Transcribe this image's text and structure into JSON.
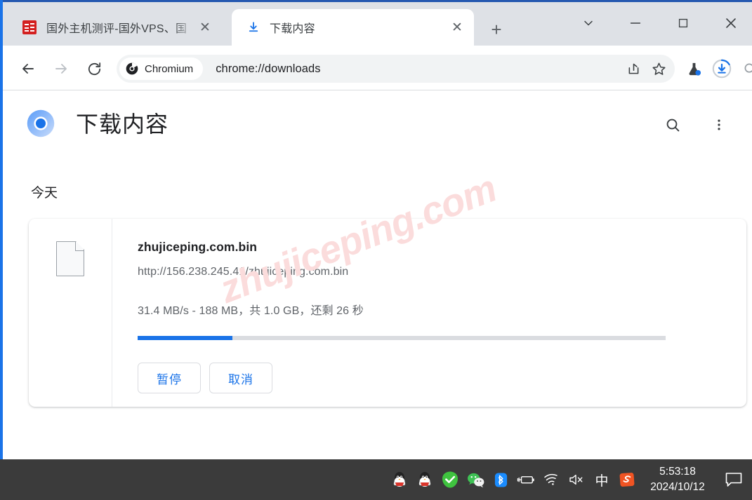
{
  "window": {
    "controls": [
      {
        "name": "tab-search",
        "icon": "chevron-down-icon",
        "label": "∨"
      },
      {
        "name": "minimize",
        "icon": "minimize-icon",
        "label": "—"
      },
      {
        "name": "maximize",
        "icon": "maximize-icon",
        "label": "□"
      },
      {
        "name": "close",
        "icon": "close-icon",
        "label": "✕"
      }
    ],
    "accent_color": "#1a73e8",
    "frame_color": "#dee1e6"
  },
  "tabs": [
    {
      "title": "国外主机测评-国外VPS、国",
      "favicon": "red-seal-favicon",
      "active": false,
      "close_label": "✕"
    },
    {
      "title": "下载内容",
      "favicon": "download-icon",
      "active": true,
      "close_label": "✕"
    }
  ],
  "newtab": {
    "label": "+",
    "name": "new-tab-button"
  },
  "toolbar": {
    "back": "←",
    "forward": "→",
    "reload": "⟳",
    "chip_label": "Chromium",
    "url": "chrome://downloads",
    "share_icon": "share-icon",
    "bookmark_icon": "star-icon",
    "extensions_icon": "flask-icon",
    "downloads_icon": "download-progress-icon",
    "search_icon": "search-icon",
    "sidepanel_icon": "side-panel-icon",
    "profile_icon": "avatar-icon",
    "menu_icon": "three-dot-menu-icon"
  },
  "page": {
    "title": "下载内容",
    "logo": "chromium-logo",
    "search_icon": "search-icon",
    "menu_icon": "three-dot-menu-icon",
    "day_label": "今天",
    "watermark": "zhujiceping.com"
  },
  "download": {
    "file_icon": "generic-file-icon",
    "filename": "zhujiceping.com.bin",
    "url": "http://156.238.245.41/zhujiceping.com.bin",
    "status": "31.4 MB/s - 188 MB，共 1.0 GB，还剩 26 秒",
    "progress_percent": 18,
    "progress_fill_color": "#1a73e8",
    "progress_track_color": "#dadce0",
    "pause_label": "暂停",
    "cancel_label": "取消"
  },
  "taskbar": {
    "background": "#3b3b3b",
    "tray_icons": [
      {
        "name": "qq-icon-1",
        "glyph": ""
      },
      {
        "name": "qq-icon-2",
        "glyph": ""
      },
      {
        "name": "security-check-icon",
        "glyph": "✓"
      },
      {
        "name": "wechat-icon",
        "glyph": ""
      },
      {
        "name": "bluetooth-icon",
        "glyph": ""
      },
      {
        "name": "battery-charging-icon",
        "glyph": ""
      },
      {
        "name": "wifi-icon",
        "glyph": ""
      },
      {
        "name": "volume-muted-icon",
        "glyph": ""
      },
      {
        "name": "ime-chinese-icon",
        "glyph": "中"
      },
      {
        "name": "sogou-icon",
        "glyph": "S"
      }
    ],
    "time": "5:53:18",
    "date": "2024/10/12",
    "notification_icon": "notification-icon"
  }
}
